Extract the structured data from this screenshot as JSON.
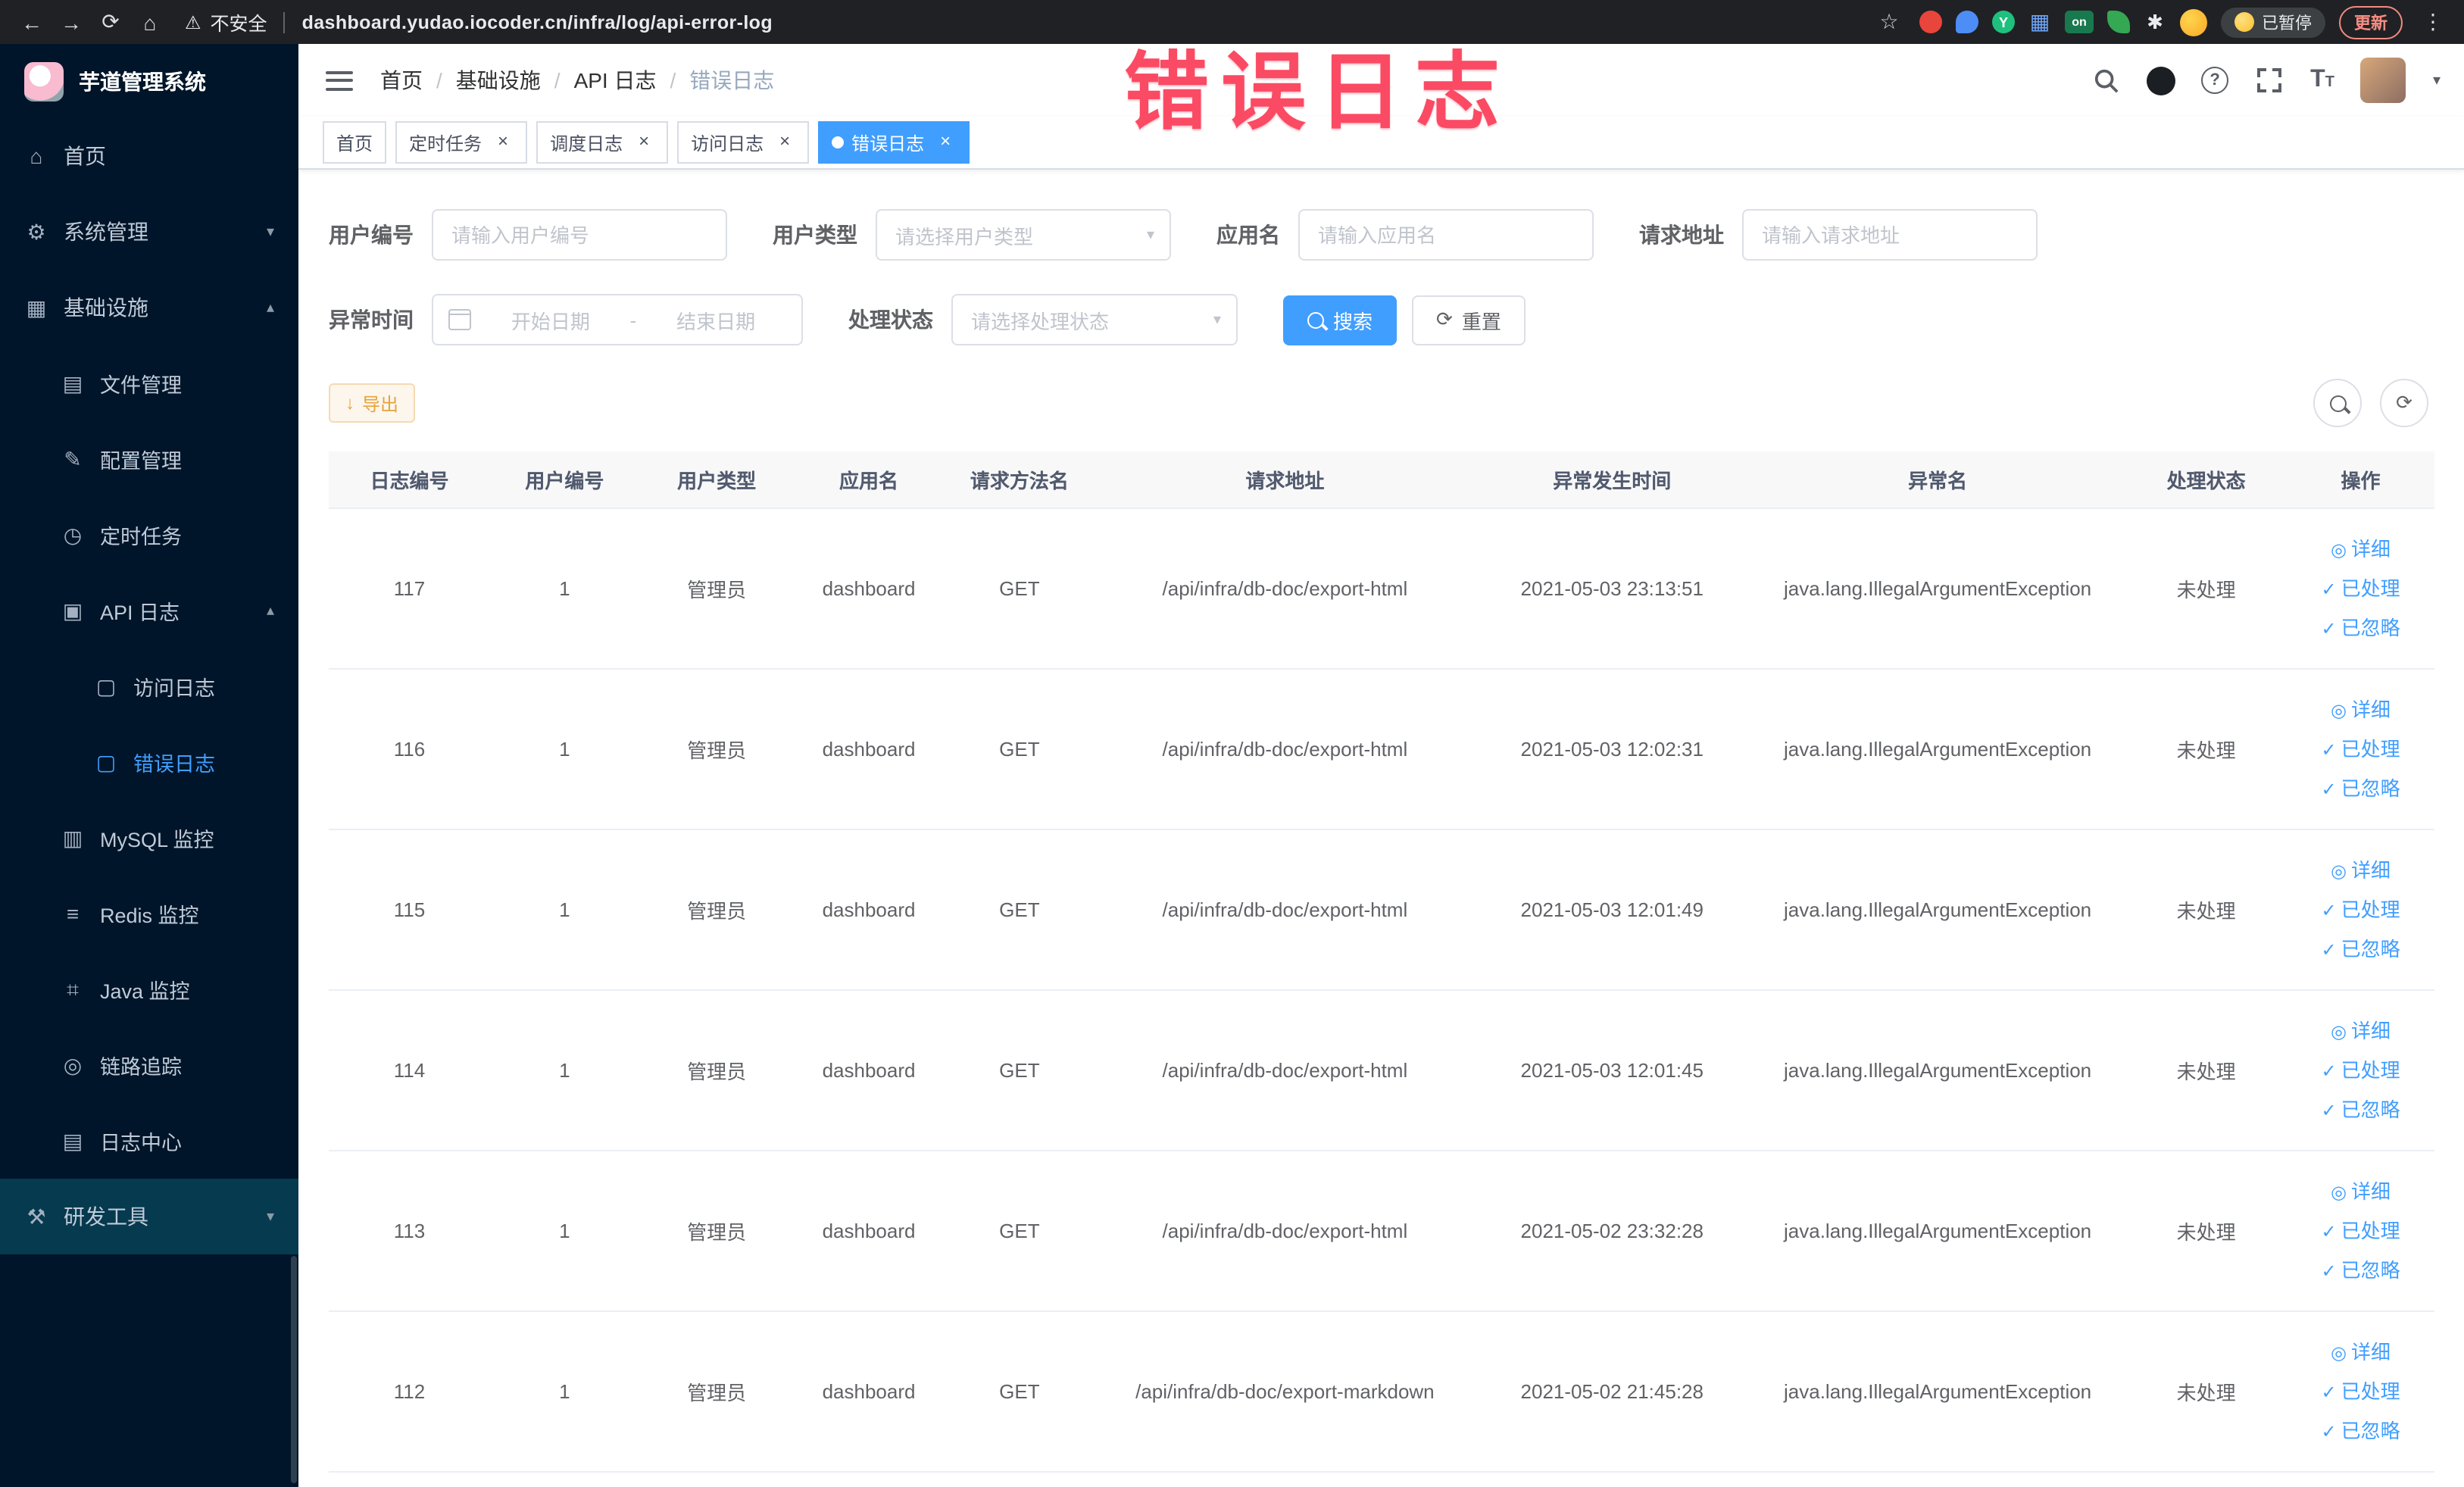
{
  "icons": {
    "back": "←",
    "forward": "→",
    "reload": "⟳",
    "home": "⌂",
    "warning": "⚠",
    "star": "☆",
    "kebab": "⋮",
    "pinwheel": "✱",
    "grid": "▦",
    "menu_home": "⌂",
    "menu_system": "⚙",
    "menu_infra": "▦",
    "menu_file": "▤",
    "menu_config": "✎",
    "menu_job": "◷",
    "menu_api": "▣",
    "menu_log": "▢",
    "menu_mysql": "▥",
    "menu_redis": "≡",
    "menu_java": "⌗",
    "menu_trace": "◎",
    "menu_center": "▤",
    "menu_dev": "⚒",
    "chevron_down": "▾",
    "chevron_up": "▴",
    "caret_down": "▾",
    "close": "×",
    "check": "✓",
    "eye": "◎",
    "download": "↓",
    "refresh": "⟳"
  },
  "browser": {
    "security_label": "不安全",
    "url": "dashboard.yudao.iocoder.cn/infra/log/api-error-log",
    "y_badge": "Y",
    "on_badge": "on",
    "paused_label": "已暂停",
    "update_label": "更新"
  },
  "overlay": {
    "text": "错误日志"
  },
  "sidebar": {
    "logo_title": "芋道管理系统",
    "menu": {
      "home": "首页",
      "system": "系统管理",
      "infra": "基础设施",
      "file": "文件管理",
      "config": "配置管理",
      "job": "定时任务",
      "api_log": "API 日志",
      "access_log": "访问日志",
      "error_log": "错误日志",
      "mysql": "MySQL 监控",
      "redis": "Redis 监控",
      "java": "Java 监控",
      "trace": "链路追踪",
      "log_center": "日志中心",
      "dev": "研发工具"
    }
  },
  "header": {
    "breadcrumb": [
      "首页",
      "基础设施",
      "API 日志",
      "错误日志"
    ],
    "separator": "/"
  },
  "tabs": [
    {
      "label": "首页"
    },
    {
      "label": "定时任务"
    },
    {
      "label": "调度日志"
    },
    {
      "label": "访问日志"
    },
    {
      "label": "错误日志"
    }
  ],
  "filters": {
    "user_id": {
      "label": "用户编号",
      "placeholder": "请输入用户编号"
    },
    "user_type": {
      "label": "用户类型",
      "placeholder": "请选择用户类型"
    },
    "app_name": {
      "label": "应用名",
      "placeholder": "请输入应用名"
    },
    "request_url": {
      "label": "请求地址",
      "placeholder": "请输入请求地址"
    },
    "exception_time": {
      "label": "异常时间",
      "start": "开始日期",
      "separator": "-",
      "end": "结束日期"
    },
    "process_status": {
      "label": "处理状态",
      "placeholder": "请选择处理状态"
    },
    "search_label": "搜索",
    "reset_label": "重置"
  },
  "toolbar": {
    "export_label": "导出"
  },
  "table": {
    "columns": [
      "日志编号",
      "用户编号",
      "用户类型",
      "应用名",
      "请求方法名",
      "请求地址",
      "异常发生时间",
      "异常名",
      "处理状态",
      "操作"
    ],
    "actions": {
      "detail": "详细",
      "processed": "已处理",
      "ignored": "已忽略"
    },
    "rows": [
      {
        "id": "117",
        "user_id": "1",
        "user_type": "管理员",
        "app": "dashboard",
        "method": "GET",
        "url": "/api/infra/db-doc/export-html",
        "time": "2021-05-03 23:13:51",
        "exception": "java.lang.IllegalArgumentException",
        "status": "未处理"
      },
      {
        "id": "116",
        "user_id": "1",
        "user_type": "管理员",
        "app": "dashboard",
        "method": "GET",
        "url": "/api/infra/db-doc/export-html",
        "time": "2021-05-03 12:02:31",
        "exception": "java.lang.IllegalArgumentException",
        "status": "未处理"
      },
      {
        "id": "115",
        "user_id": "1",
        "user_type": "管理员",
        "app": "dashboard",
        "method": "GET",
        "url": "/api/infra/db-doc/export-html",
        "time": "2021-05-03 12:01:49",
        "exception": "java.lang.IllegalArgumentException",
        "status": "未处理"
      },
      {
        "id": "114",
        "user_id": "1",
        "user_type": "管理员",
        "app": "dashboard",
        "method": "GET",
        "url": "/api/infra/db-doc/export-html",
        "time": "2021-05-03 12:01:45",
        "exception": "java.lang.IllegalArgumentException",
        "status": "未处理"
      },
      {
        "id": "113",
        "user_id": "1",
        "user_type": "管理员",
        "app": "dashboard",
        "method": "GET",
        "url": "/api/infra/db-doc/export-html",
        "time": "2021-05-02 23:32:28",
        "exception": "java.lang.IllegalArgumentException",
        "status": "未处理"
      },
      {
        "id": "112",
        "user_id": "1",
        "user_type": "管理员",
        "app": "dashboard",
        "method": "GET",
        "url": "/api/infra/db-doc/export-markdown",
        "time": "2021-05-02 21:45:28",
        "exception": "java.lang.IllegalArgumentException",
        "status": "未处理"
      }
    ]
  }
}
